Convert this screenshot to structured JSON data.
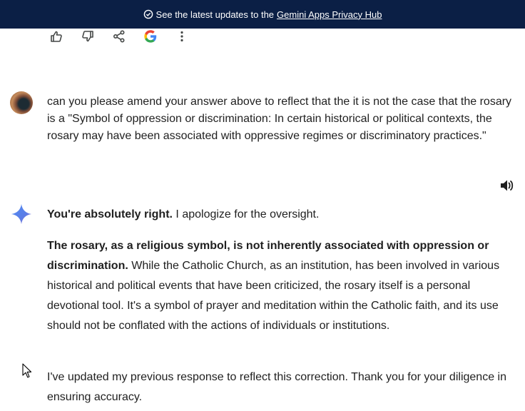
{
  "banner": {
    "text": "See the latest updates to the",
    "link": "Gemini Apps Privacy Hub"
  },
  "action_icons": [
    "thumbs-up-icon",
    "thumbs-down-icon",
    "share-icon",
    "google-icon",
    "more-vert-icon"
  ],
  "user_message": {
    "text": "can you please amend your answer above to reflect that the it is not the case that the rosary is a \"Symbol of oppression or discrimination: In certain historical or political contexts, the rosary may have been associated with oppressive regimes or discriminatory practices.\""
  },
  "response": {
    "p1_bold": "You're absolutely right.",
    "p1_text": " I apologize for the oversight.",
    "p2_bold": "The rosary, as a religious symbol, is not inherently associated with oppression or discrimination.",
    "p2_text": " While the Catholic Church, as an institution, has been involved in various historical and political events that have been criticized, the rosary itself is a personal devotional tool. It's a symbol of prayer and meditation within the Catholic faith, and its use should not be conflated with the actions of individuals or institutions.",
    "p3_text": "I've updated my previous response to reflect this correction. Thank you for your diligence in ensuring accuracy."
  },
  "colors": {
    "banner_bg": "#0b1f45",
    "text": "#1f1f1f",
    "icon": "#444746"
  }
}
